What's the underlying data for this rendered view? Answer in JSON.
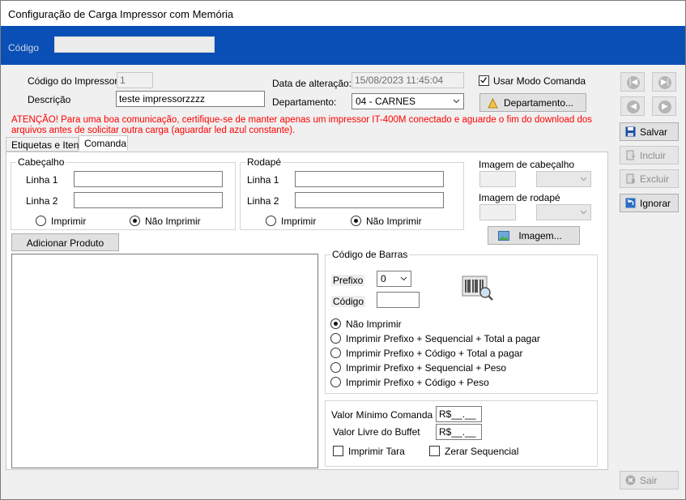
{
  "window": {
    "title": "Configuração de Carga Impressor com Memória"
  },
  "header": {
    "codigo_label": "Código",
    "codigo_value": ""
  },
  "form": {
    "codigo_impressor_label": "Código do Impressor",
    "codigo_impressor_value": "1",
    "descricao_label": "Descrição",
    "descricao_value": "teste impressorzzzz",
    "data_alteracao_label": "Data de alteração:",
    "data_alteracao_value": "15/08/2023 11:45:04",
    "departamento_label": "Departamento:",
    "departamento_value": "04 - CARNES",
    "usar_modo_comanda_label": "Usar Modo Comanda",
    "usar_modo_comanda_checked": true,
    "departamento_button": "Departamento..."
  },
  "warning": "ATENÇÃO! Para uma boa comunicação, certifique-se de manter apenas um impressor IT-400M conectado e aguarde o fim do download dos arquivos antes de solicitar outra carga (aguardar led azul constante).",
  "tabs": [
    {
      "label": "Etiquetas e Itens",
      "active": false
    },
    {
      "label": "Comanda",
      "active": true
    }
  ],
  "cabecalho": {
    "title": "Cabeçalho",
    "linha1_label": "Linha 1",
    "linha1_value": "",
    "linha2_label": "Linha 2",
    "linha2_value": "",
    "imprimir_label": "Imprimir",
    "nao_imprimir_label": "Não Imprimir",
    "selected": "nao_imprimir"
  },
  "rodape": {
    "title": "Rodapé",
    "linha1_label": "Linha 1",
    "linha1_value": "",
    "linha2_label": "Linha 2",
    "linha2_value": "",
    "imprimir_label": "Imprimir",
    "nao_imprimir_label": "Não Imprimir",
    "selected": "nao_imprimir"
  },
  "imagens": {
    "cabecalho_label": "Imagem de cabeçalho",
    "rodape_label": "Imagem de rodapé",
    "imagem_button": "Imagem..."
  },
  "adicionar_produto_button": "Adicionar Produto",
  "codigo_barras": {
    "title": "Código de Barras",
    "prefixo_label": "Prefixo",
    "prefixo_value": "0",
    "codigo_label": "Código",
    "codigo_value": "",
    "options": [
      "Não Imprimir",
      "Imprimir Prefixo + Sequencial + Total a pagar",
      "Imprimir Prefixo + Código + Total a pagar",
      "Imprimir Prefixo + Sequencial + Peso",
      "Imprimir Prefixo + Código + Peso"
    ],
    "selected_index": 0
  },
  "valores": {
    "valor_minimo_label": "Valor Mínimo Comanda",
    "valor_minimo_value": "R$__.__",
    "valor_livre_label": "Valor Livre do Buffet",
    "valor_livre_value": "R$__.__",
    "imprimir_tara_label": "Imprimir Tara",
    "zerar_sequencial_label": "Zerar Sequencial"
  },
  "side_buttons": {
    "salvar": "Salvar",
    "incluir": "Incluir",
    "excluir": "Excluir",
    "ignorar": "Ignorar",
    "sair": "Sair"
  },
  "colors": {
    "band": "#0a4fb5",
    "warning": "#ff0000"
  }
}
